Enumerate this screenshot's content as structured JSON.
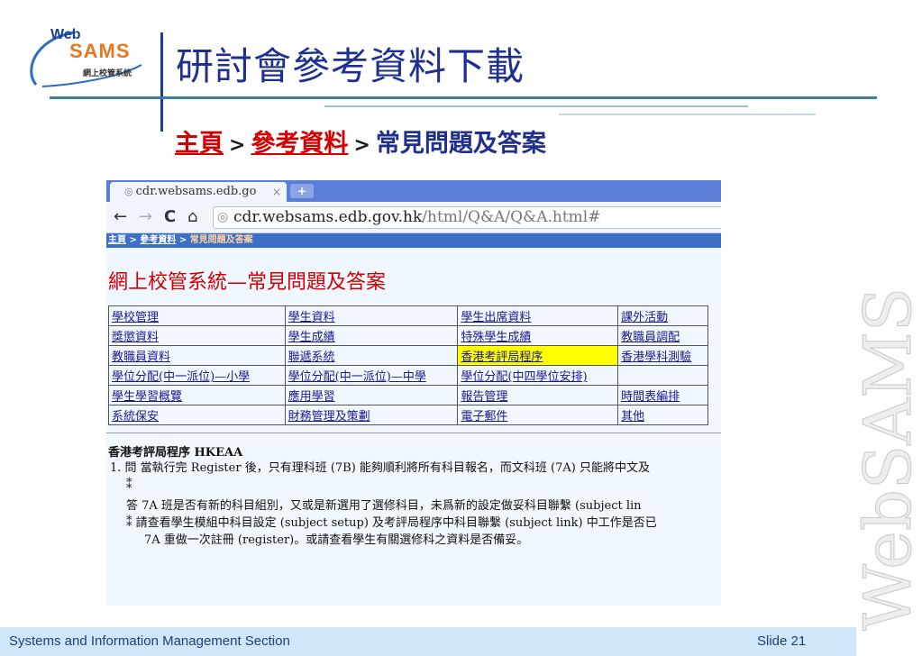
{
  "header": {
    "logo_web": "Web",
    "logo_sams": "SAMS",
    "logo_sub": "網上校管系統",
    "title": "研討會參考資料下載",
    "breadcrumb": {
      "home": "主頁",
      "sep": ">",
      "ref": "參考資料",
      "current": "常見問題及答案"
    }
  },
  "browser": {
    "tab_title": "cdr.websams.edb.go",
    "tab_close": "×",
    "new_tab": "+",
    "nav_back": "←",
    "nav_forward": "→",
    "nav_reload": "C",
    "nav_home": "⌂",
    "url_host": "cdr.websams.edb.gov.hk",
    "url_path": "/html/Q&A/Q&A.html#"
  },
  "site": {
    "breadcrumb_home": "主頁",
    "breadcrumb_sep": " > ",
    "breadcrumb_ref": "參考資料",
    "breadcrumb_current": "常見問題及答案",
    "heading": "網上校管系統—常見問題及答案",
    "links": [
      [
        "學校管理",
        "學生資料",
        "學生出席資料",
        "課外活動"
      ],
      [
        "獎懲資料",
        "學生成績",
        "特殊學生成績",
        "教職員調配"
      ],
      [
        "教職員資料",
        "聯遞系統",
        "香港考評局程序",
        "香港學科測驗"
      ],
      [
        "學位分配(中一派位)—小學",
        "學位分配(中一派位)—中學",
        "學位分配(中四學位安排)",
        ""
      ],
      [
        "學生學習概覽",
        "應用學習",
        "報告管理",
        "時間表編排"
      ],
      [
        "系統保安",
        "財務管理及策劃",
        "電子郵件",
        "其他"
      ]
    ],
    "faq_heading": "香港考評局程序 HKEAA",
    "faq_q": "1. 問 當執行完 Register 後，只有理科班 (7B) 能夠順利將所有科目報名，而文科班 (7A) 只能將中文及",
    "faq_bullet": "⁑",
    "faq_a1": "答 7A 班是否有新的科目組別，又或是新選用了選修科目，未爲新的設定做妥科目聯繫 (subject lin",
    "faq_a2": "⁑ 請查看學生模組中科目設定 (subject setup) 及考評局程序中科目聯繫 (subject link) 中工作是否已",
    "faq_a3": "7A 重做一次註冊 (register)。或請查看學生有關選修科之資料是否備妥。"
  },
  "watermark": "WebSAMS",
  "footer": {
    "org": "Systems and Information Management Section",
    "slide": "Slide 21"
  },
  "colors": {
    "title": "#1f2f8f",
    "link_red": "#d40000",
    "tab_bar": "#5b7fd6",
    "highlight": "#ffff00",
    "footer": "#cfe7f8"
  }
}
